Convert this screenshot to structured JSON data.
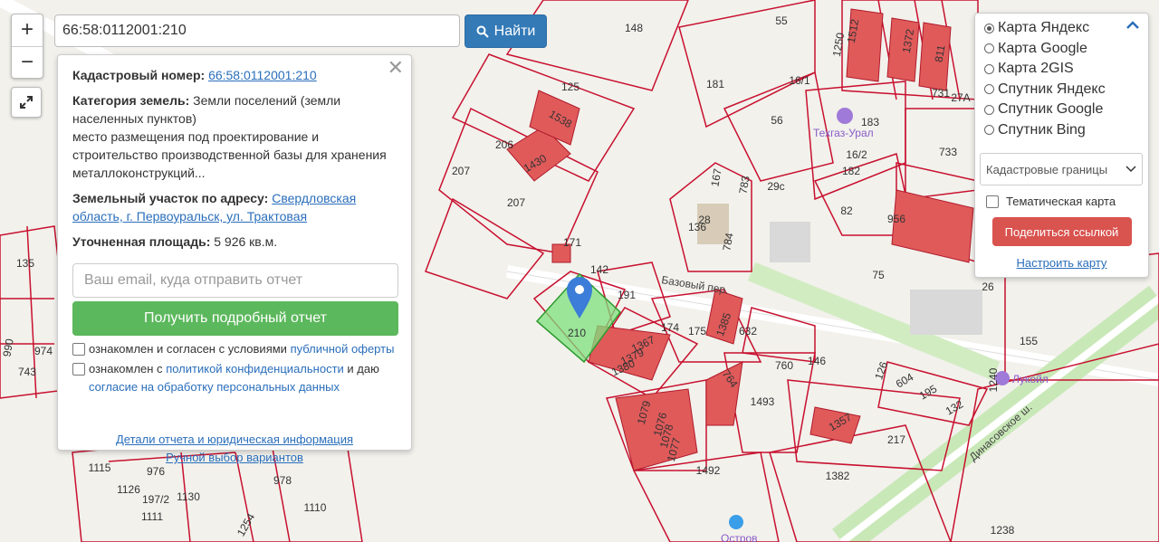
{
  "search": {
    "value": "66:58:0112001:210",
    "button_label": "Найти"
  },
  "info": {
    "cadastral_label": "Кадастровый номер:",
    "cadastral_value": "66:58:0112001:210",
    "category_label": "Категория земель:",
    "category_value": "Земли поселений (земли населенных пунктов)",
    "purpose": "место размещения под проектирование и строительство производственной базы для хранения металлоконструкций...",
    "address_label": "Земельный участок по адресу:",
    "address_value": "Свердловская область, г. Первоуральск, ул. Трактовая",
    "area_label": "Уточненная площадь:",
    "area_value": "5 926 кв.м.",
    "email_placeholder": "Ваш email, куда отправить отчет",
    "report_button": "Получить подробный отчет",
    "consent1_text": "ознакомлен и согласен с условиями",
    "consent1_link": "публичной оферты",
    "consent2_text": "ознакомлен с",
    "consent2_link1": "политикой конфиденциальности",
    "consent2_mid": "и даю",
    "consent2_link2": "согласие на обработку персональных данных",
    "link_details": "Детали отчета и юридическая информация",
    "link_manual": "Ручной выбор вариантов"
  },
  "layers": {
    "options": [
      {
        "label": "Карта Яндекс",
        "selected": true
      },
      {
        "label": "Карта Google",
        "selected": false
      },
      {
        "label": "Карта 2GIS",
        "selected": false
      },
      {
        "label": "Спутник Яндекс",
        "selected": false
      },
      {
        "label": "Спутник Google",
        "selected": false
      },
      {
        "label": "Спутник Bing",
        "selected": false
      }
    ],
    "overlay_select": "Кадастровые границы",
    "thematic_label": "Тематическая карта",
    "share_button": "Поделиться ссылкой",
    "configure_link": "Настроить карту"
  },
  "map": {
    "parcels": [
      "148",
      "55",
      "1512",
      "125",
      "181",
      "1538",
      "206",
      "1430",
      "207",
      "207",
      "56",
      "183",
      "182",
      "733",
      "82",
      "956",
      "171",
      "167",
      "783",
      "28",
      "136",
      "784",
      "142",
      "191",
      "210",
      "75",
      "174",
      "175",
      "1385",
      "632",
      "1367",
      "1379",
      "1380",
      "764",
      "760",
      "146",
      "1493",
      "1357",
      "217",
      "126",
      "604",
      "195",
      "132",
      "155",
      "1079",
      "1076",
      "1078",
      "1077",
      "1492",
      "1382",
      "1238",
      "1115",
      "1126",
      "976",
      "978",
      "1110",
      "1111",
      "197/2",
      "1130",
      "1254",
      "135",
      "990",
      "974",
      "743",
      "1250",
      "1372",
      "811",
      "731",
      "27А",
      "16/2",
      "16/1",
      "29с",
      "26",
      "1240"
    ],
    "streets": [
      "Базовый пер.",
      "Динасовское ш."
    ],
    "pois": [
      "Техгаз-Урал",
      "Лукойл",
      "Остров"
    ],
    "colors": {
      "boundary": "#c8102e",
      "building": "#e05a5a",
      "selected": "#7ee07e",
      "marker": "#3b7dd8"
    }
  }
}
